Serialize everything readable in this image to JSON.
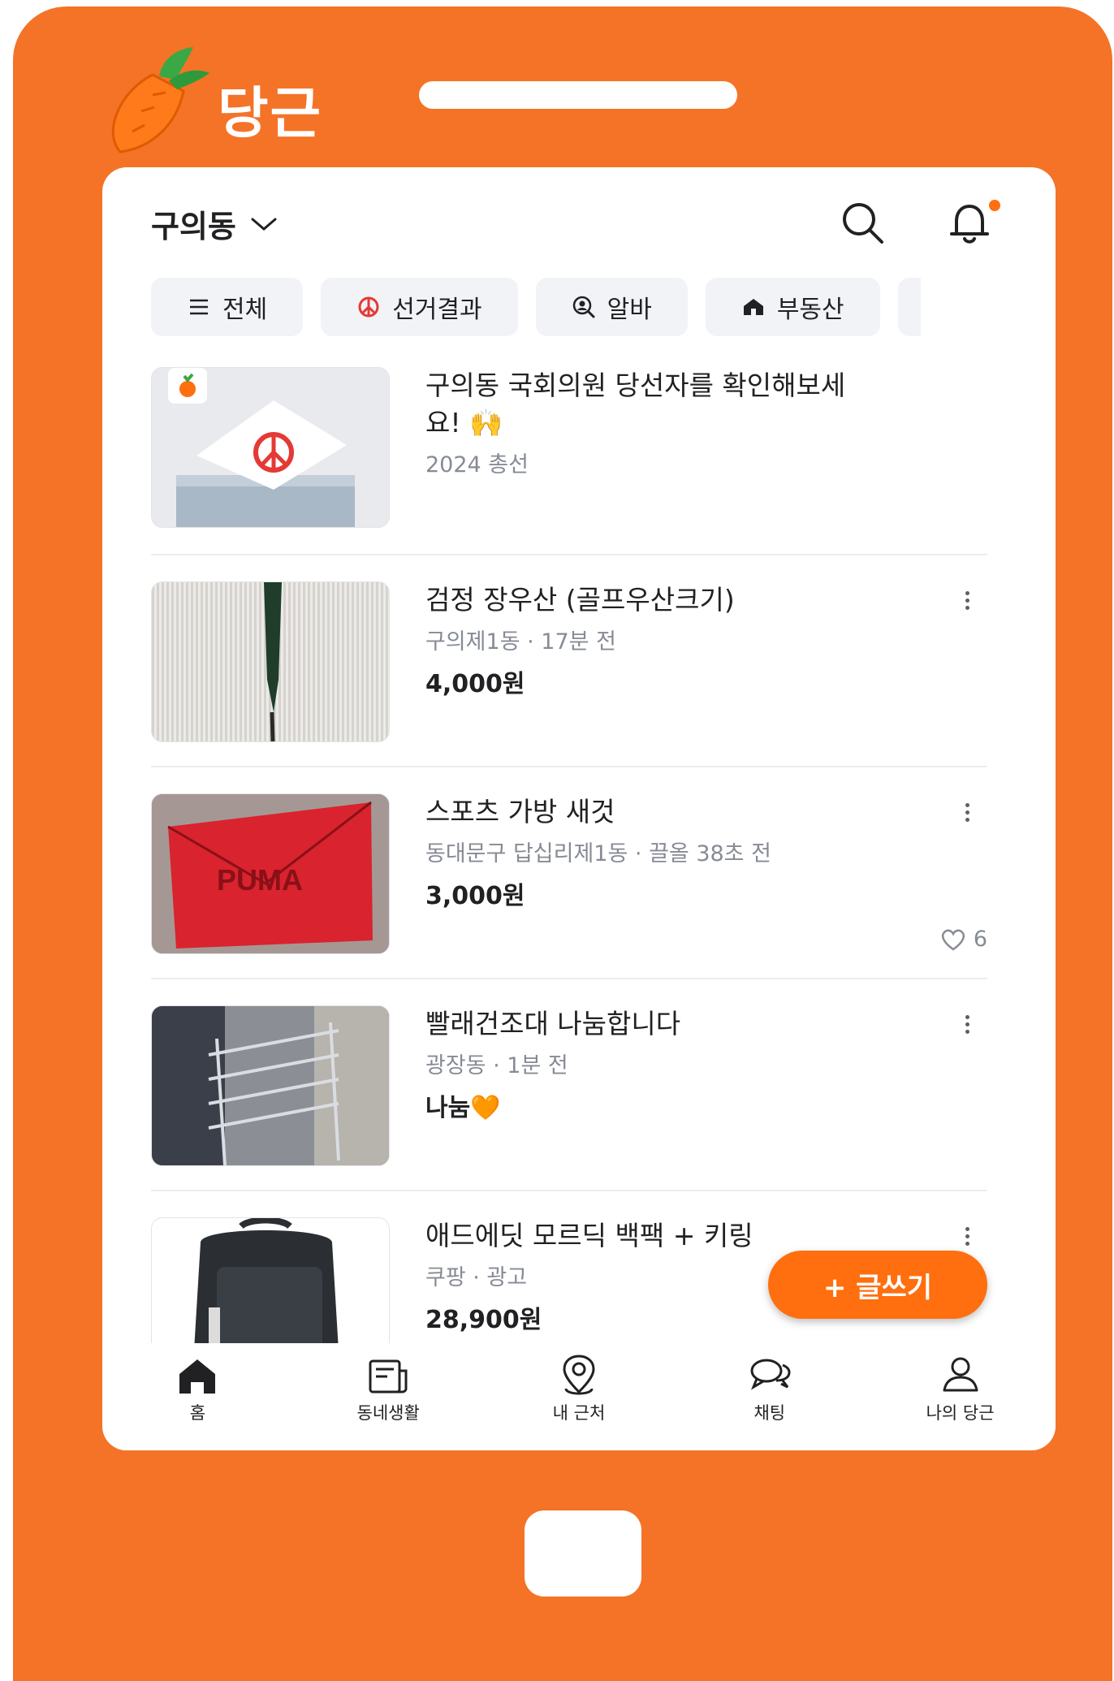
{
  "brand": {
    "name": "당근"
  },
  "header": {
    "location": "구의동"
  },
  "chips": [
    {
      "icon": "menu-icon",
      "label": "전체"
    },
    {
      "icon": "vote-icon",
      "label": "선거결과"
    },
    {
      "icon": "person-search-icon",
      "label": "알바"
    },
    {
      "icon": "house-icon",
      "label": "부동산"
    }
  ],
  "banner": {
    "title": "구의동 국회의원 당선자를 확인해보세요! 🙌",
    "subtitle": "2024 총선"
  },
  "items": [
    {
      "title": "검정 장우산 (골프우산크기)",
      "meta": "구의제1동 · 17분 전",
      "price": "4,000원"
    },
    {
      "title": "스포츠 가방 새것",
      "meta": "동대문구 답십리제1동 · 끌올 38초 전",
      "price": "3,000원",
      "likes": "6"
    },
    {
      "title": "빨래건조대 나눔합니다",
      "meta": "광장동 · 1분 전",
      "price": "나눔🧡"
    },
    {
      "title": "애드에딧 모르딕 백팩 + 키링",
      "meta": "쿠팡 · 광고",
      "price": "28,900원"
    }
  ],
  "fab": {
    "label": "+ 글쓰기"
  },
  "nav": [
    {
      "icon": "home-icon",
      "label": "홈"
    },
    {
      "icon": "newspaper-icon",
      "label": "동네생활"
    },
    {
      "icon": "location-pin-icon",
      "label": "내 근처"
    },
    {
      "icon": "chat-icon",
      "label": "채팅"
    },
    {
      "icon": "person-icon",
      "label": "나의 당근"
    }
  ],
  "colors": {
    "brand_orange": "#f47327",
    "accent": "#ff6f0f",
    "text": "#212124",
    "muted": "#868b94"
  }
}
